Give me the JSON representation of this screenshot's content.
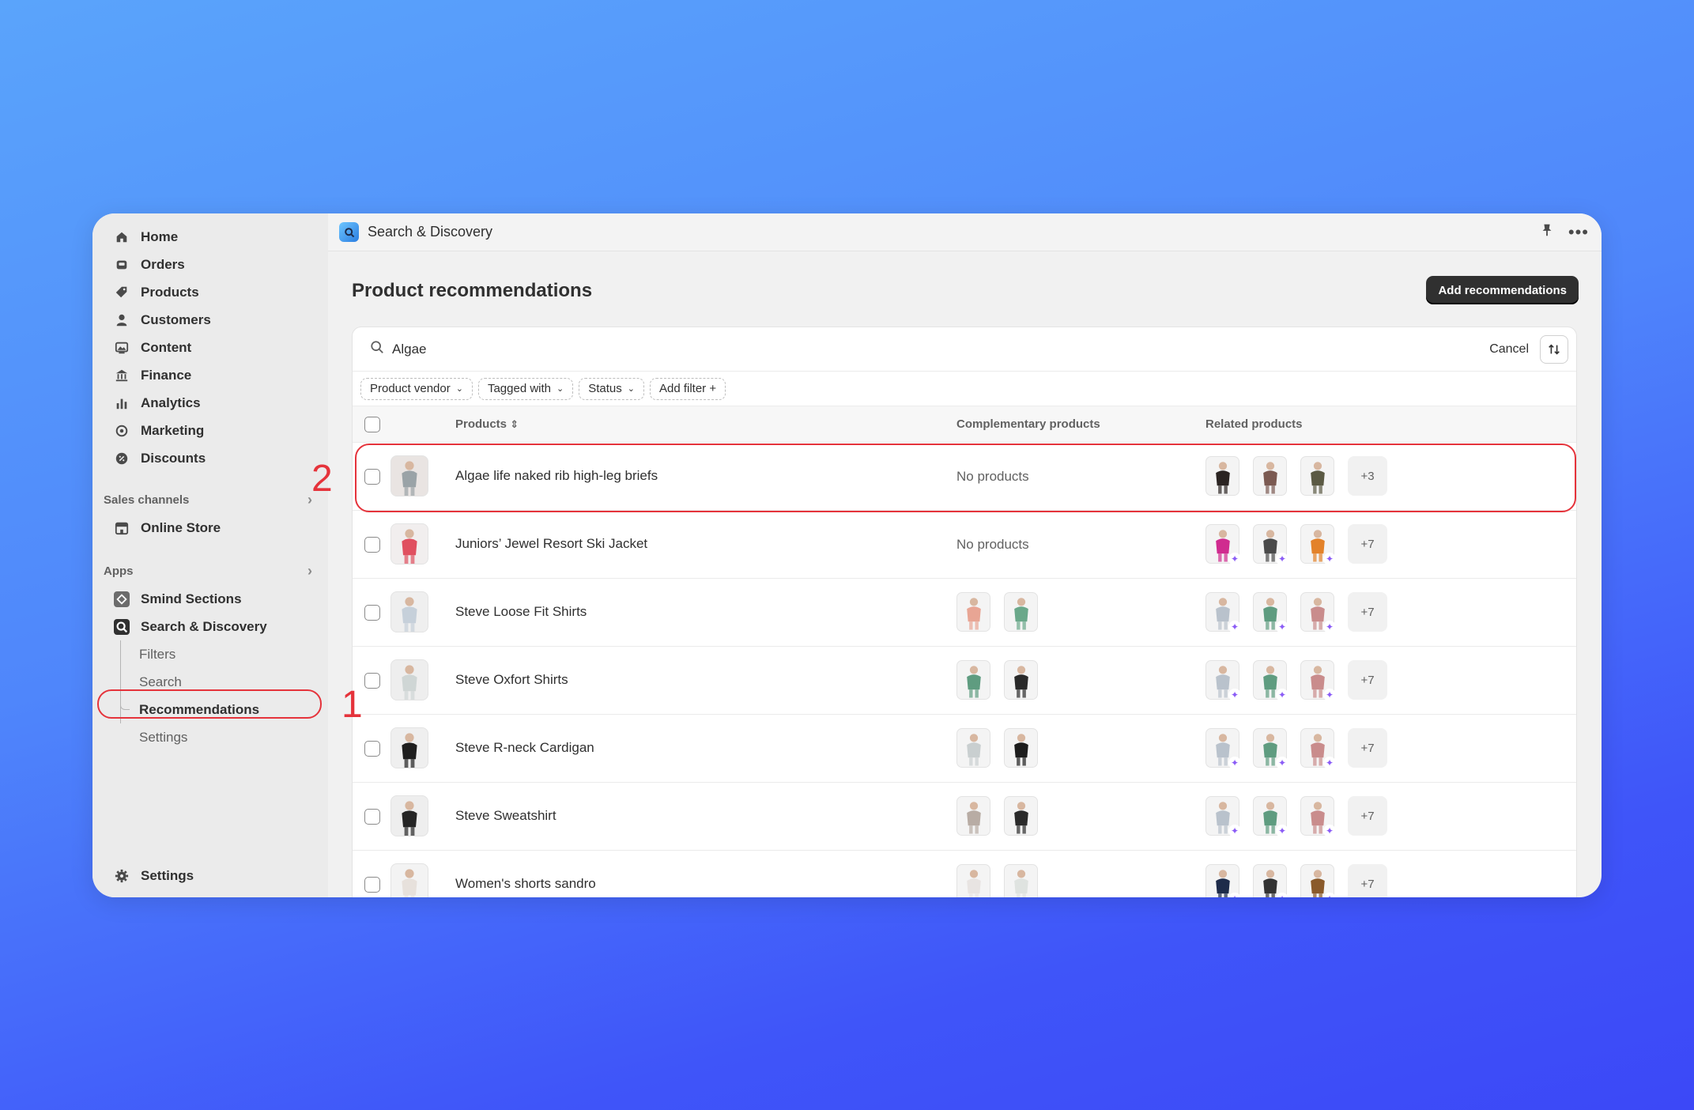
{
  "sidebar": {
    "nav": [
      {
        "label": "Home",
        "icon": "home-icon"
      },
      {
        "label": "Orders",
        "icon": "inbox-icon"
      },
      {
        "label": "Products",
        "icon": "tag-icon"
      },
      {
        "label": "Customers",
        "icon": "person-icon"
      },
      {
        "label": "Content",
        "icon": "image-icon"
      },
      {
        "label": "Finance",
        "icon": "bank-icon"
      },
      {
        "label": "Analytics",
        "icon": "bar-chart-icon"
      },
      {
        "label": "Marketing",
        "icon": "target-icon"
      },
      {
        "label": "Discounts",
        "icon": "discount-icon"
      }
    ],
    "sales_channels_label": "Sales channels",
    "online_store": "Online Store",
    "apps_label": "Apps",
    "apps": [
      "Smind Sections",
      "Search & Discovery"
    ],
    "sub_items": [
      "Filters",
      "Search",
      "Recommendations",
      "Settings"
    ],
    "settings_label": "Settings"
  },
  "topbar": {
    "app_title": "Search & Discovery"
  },
  "page": {
    "title": "Product recommendations",
    "primary_action": "Add recommendations"
  },
  "search": {
    "query": "Algae",
    "cancel_label": "Cancel"
  },
  "filters": [
    "Product vendor",
    "Tagged with",
    "Status",
    "Add filter +"
  ],
  "table": {
    "headers": {
      "products": "Products",
      "complementary": "Complementary products",
      "related": "Related products"
    },
    "rows": [
      {
        "name": "Algae life naked rib high-leg briefs",
        "complementary": "No products",
        "related_more": "+3"
      },
      {
        "name": "Juniors’ Jewel Resort Ski Jacket",
        "complementary": "No products",
        "related_more": "+7"
      },
      {
        "name": "Steve Loose Fit Shirts",
        "complementary": "",
        "related_more": "+7"
      },
      {
        "name": "Steve Oxfort Shirts",
        "complementary": "",
        "related_more": "+7"
      },
      {
        "name": "Steve R-neck Cardigan",
        "complementary": "",
        "related_more": "+7"
      },
      {
        "name": "Steve Sweatshirt",
        "complementary": "",
        "related_more": "+7"
      },
      {
        "name": "Women's shorts sandro",
        "complementary": "",
        "related_more": "+7"
      }
    ]
  },
  "annotations": {
    "one": "1",
    "two": "2"
  },
  "colors": {
    "accent_red": "#e5333b",
    "sparkle": "#8b5cf6",
    "primary_btn": "#303030"
  }
}
